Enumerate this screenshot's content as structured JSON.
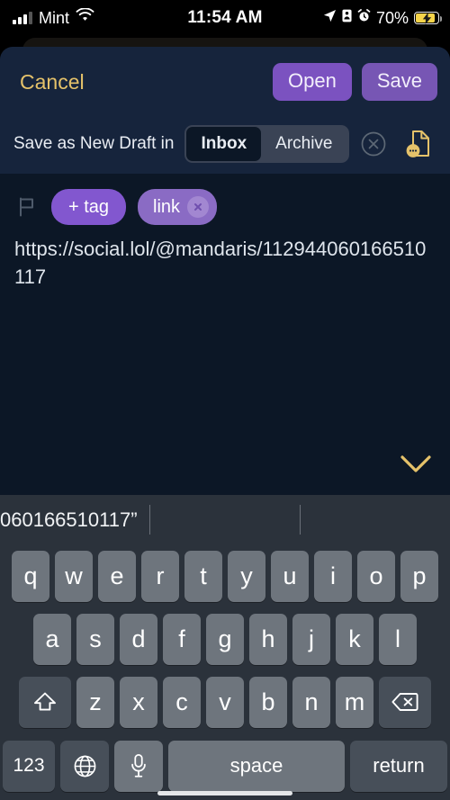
{
  "status_bar": {
    "carrier": "Mint",
    "time": "11:54 AM",
    "battery_percent": "70%",
    "icons": [
      "signal-bars-icon",
      "wifi-icon",
      "location-arrow-icon",
      "portrait-lock-icon",
      "alarm-clock-icon",
      "battery-charging-icon"
    ]
  },
  "sheet": {
    "cancel_label": "Cancel",
    "open_label": "Open",
    "save_label": "Save",
    "draft_label": "Save as New Draft in",
    "folders": [
      {
        "label": "Inbox",
        "selected": true
      },
      {
        "label": "Archive",
        "selected": false
      }
    ],
    "clear_icon": "circle-x-icon",
    "note_icon": "document-comment-icon",
    "flag_icon": "flag-outline-icon",
    "add_tag_label": "+ tag",
    "tags": [
      {
        "label": "link",
        "removable": true
      }
    ],
    "note_text": "https://social.lol/@mandaris/112944060166510117",
    "dismiss_icon": "chevron-down-icon"
  },
  "keyboard": {
    "suggestions": [
      "060166510117”",
      "",
      ""
    ],
    "row1": [
      "q",
      "w",
      "e",
      "r",
      "t",
      "y",
      "u",
      "i",
      "o",
      "p"
    ],
    "row2": [
      "a",
      "s",
      "d",
      "f",
      "g",
      "h",
      "j",
      "k",
      "l"
    ],
    "row3": [
      "z",
      "x",
      "c",
      "v",
      "b",
      "n",
      "m"
    ],
    "shift_icon": "shift-arrow-icon",
    "backspace_icon": "backspace-icon",
    "numbers_label": "123",
    "globe_icon": "globe-icon",
    "mic_icon": "microphone-icon",
    "space_label": "space",
    "return_label": "return"
  },
  "colors": {
    "accent_purple": "#7b52c0",
    "accent_gold": "#e5c26a",
    "sheet_header": "#16243c",
    "sheet_body": "#0c1726",
    "keyboard_bg": "#2b323b",
    "key_bg": "#6e757d",
    "key_dark": "#474f59"
  }
}
